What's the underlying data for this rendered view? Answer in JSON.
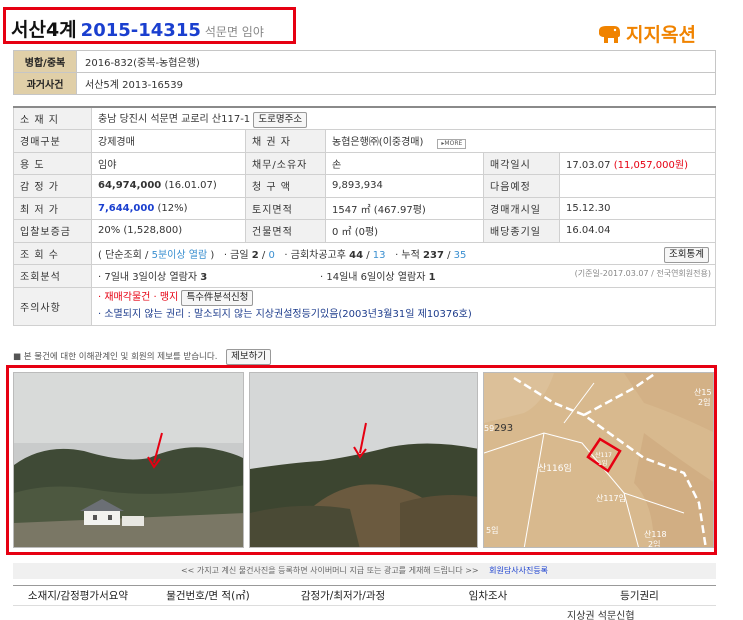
{
  "header": {
    "court_prefix": "서산4계",
    "case_number": "2015-14315",
    "location_short": "석문면 임야",
    "logo_text": "지지옥션"
  },
  "summary": {
    "merge_label": "병합/중복",
    "merge_value": "2016-832(중복-농협은행)",
    "past_label": "과거사건",
    "past_value": "서산5계 2013-16539"
  },
  "details": {
    "address_label": "소 재 지",
    "address_value": "충남 당진시 석문면 교로리 산117-1",
    "road_address_button": "도로명주소",
    "auction_type_label": "경매구분",
    "auction_type_value": "강제경매",
    "creditor_label": "채 권 자",
    "creditor_value": "농협은행㈜(이중경매)",
    "more_label": "▸MORE",
    "use_label": "용 도",
    "use_value": "임야",
    "debtor_label": "채무/소유자",
    "debtor_value": "손",
    "sale_date_label": "매각일시",
    "sale_date_value": "17.03.07",
    "sale_price_value": "(11,057,000원)",
    "appraisal_label": "감 정 가",
    "appraisal_value": "64,974,000",
    "appraisal_date": "(16.01.07)",
    "claim_label": "청 구 액",
    "claim_value": "9,893,934",
    "next_label": "다음예정",
    "next_value": "",
    "min_price_label": "최 저 가",
    "min_price_value": "7,644,000",
    "min_price_pct": "(12%)",
    "land_area_label": "토지면적",
    "land_area_value": "1547 ㎡ (467.97평)",
    "start_date_label": "경매개시일",
    "start_date_value": "15.12.30",
    "deposit_label": "입찰보증금",
    "deposit_value": "20% (1,528,800)",
    "building_area_label": "건물면적",
    "building_area_value": "0 ㎡ (0평)",
    "dividend_label": "배당종기일",
    "dividend_value": "16.04.04",
    "views_label": "조 회 수",
    "views_simple": "( 단순조회 /",
    "views_5min": "5분이상 열람",
    "views_close": ")",
    "views_today_label": "· 금일",
    "views_today_a": "2",
    "views_today_b": "0",
    "views_notice_label": "· 금회차공고후",
    "views_notice_a": "44",
    "views_notice_b": "13",
    "views_total_label": "· 누적",
    "views_total_a": "237",
    "views_total_b": "35",
    "stats_button": "조회통계",
    "analysis_label": "조회분석",
    "analysis_7day": "· 7일내 3일이상 열람자",
    "analysis_7day_count": "3",
    "analysis_14day": "· 14일내 6일이상 열람자",
    "analysis_14day_count": "1",
    "analysis_note": "(기준일-2017.03.07 / 전국연회원전용)",
    "caution_label": "주의사항",
    "caution_1": "· 재매각물건 · 맹지",
    "special_button": "특수件분석신청",
    "caution_2": "· 소멸되지 않는 권리 : 말소되지 않는 지상권설정등기있음(2003년3월31일 제10376호)"
  },
  "report": {
    "text": "■ 본 물건에 대한 이해관계인 및 회원의 제보를 받습니다.",
    "button": "제보하기"
  },
  "map": {
    "lot_293": "293",
    "lot_59": "59",
    "lot_116": "산116임",
    "lot_117_1": "산117",
    "lot_117_1b": "1임",
    "lot_117": "산117임",
    "lot_15": "산15",
    "lot_15b": "2임",
    "lot_118": "산118",
    "lot_118b": "2임",
    "lot_5": "5임"
  },
  "notice": {
    "text": "<< 가지고 계신 물건사진을 등록하면 사이버머니 지급 또는 광고를 게재해 드립니다 >>",
    "link": "회원담사사진등록"
  },
  "bottom_table": {
    "col1": "소재지/감정평가서요약",
    "col2": "물건번호/면 적(㎡)",
    "col3": "감정가/최저가/과정",
    "col4": "임차조사",
    "col5": "등기권리",
    "peek": "지상권 석문신협"
  },
  "colors": {
    "accent_red": "#e60012",
    "case_blue": "#1a3fcf",
    "label_bg": "#e0cfa8",
    "logo_orange": "#f08300"
  }
}
